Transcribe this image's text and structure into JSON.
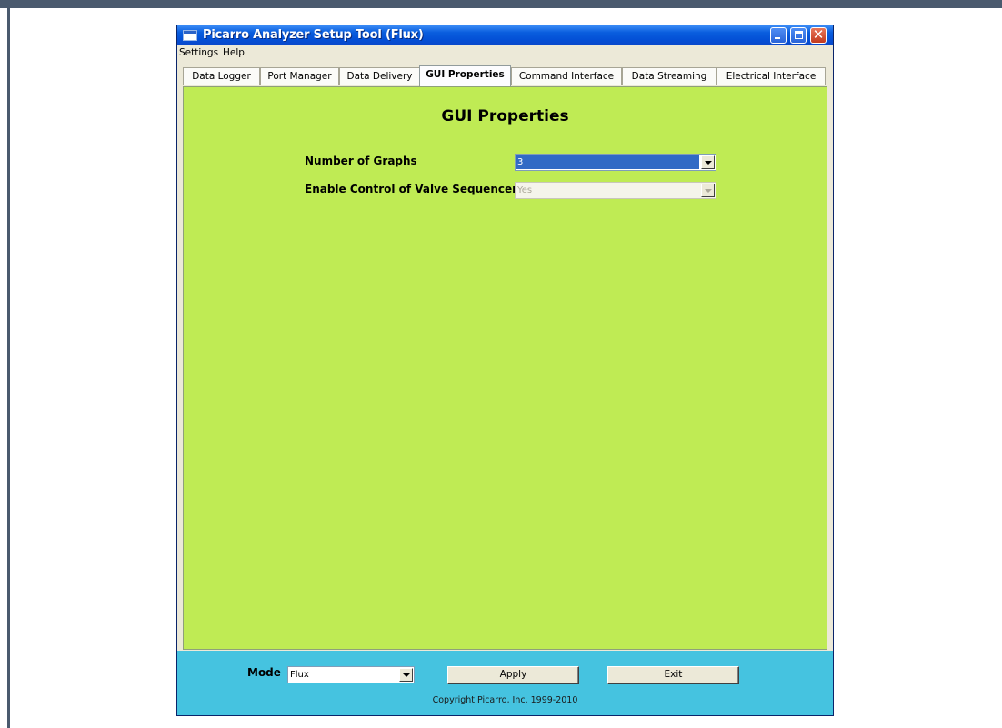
{
  "window": {
    "title": "Picarro Analyzer Setup Tool (Flux)"
  },
  "menu": {
    "items": [
      "Settings",
      "Help"
    ]
  },
  "tabs": [
    {
      "label": "Data Logger",
      "active": false
    },
    {
      "label": "Port Manager",
      "active": false
    },
    {
      "label": "Data Delivery",
      "active": false
    },
    {
      "label": "GUI Properties",
      "active": true
    },
    {
      "label": "Command Interface",
      "active": false
    },
    {
      "label": "Data Streaming",
      "active": false
    },
    {
      "label": "Electrical Interface",
      "active": false
    }
  ],
  "main": {
    "title": "GUI Properties",
    "fields": [
      {
        "label": "Number of Graphs",
        "value": "3",
        "enabled": true
      },
      {
        "label": "Enable Control of Valve Sequencer",
        "value": "Yes",
        "enabled": false
      }
    ]
  },
  "bottom": {
    "mode_label": "Mode",
    "mode_value": "Flux",
    "apply_label": "Apply",
    "exit_label": "Exit",
    "copyright": "Copyright Picarro, Inc. 1999-2010"
  },
  "colors": {
    "content_background": "#bfeb54",
    "bottom_background": "#45c3e0",
    "selection": "#316ac5"
  }
}
